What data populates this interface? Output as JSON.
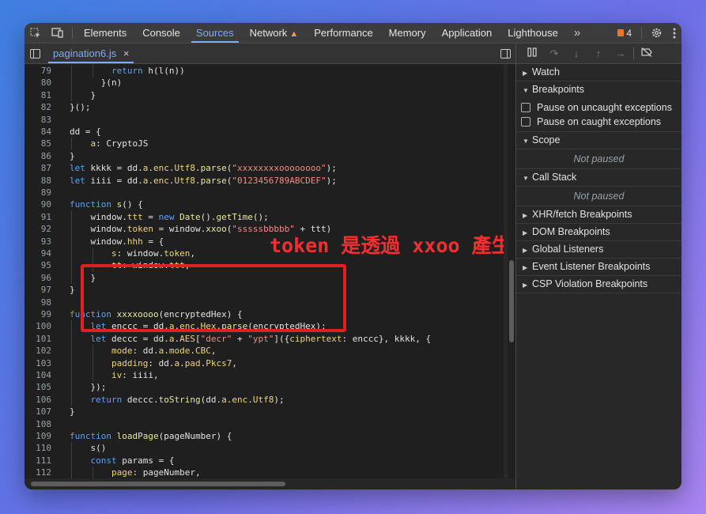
{
  "topbar": {
    "tabs": [
      "Elements",
      "Console",
      "Sources",
      "Network",
      "Performance",
      "Memory",
      "Application",
      "Lighthouse"
    ],
    "active_tab": "Sources",
    "more": "»",
    "issues_count": "4"
  },
  "editor": {
    "file_tab": "pagination6.js",
    "close": "×",
    "lines": [
      {
        "n": "79",
        "indent": 8,
        "html": "<span class='kw'>return</span> h(l(n))"
      },
      {
        "n": "80",
        "indent": 6,
        "html": "}(n)"
      },
      {
        "n": "81",
        "indent": 4,
        "html": "}"
      },
      {
        "n": "82",
        "indent": 0,
        "html": "}();"
      },
      {
        "n": "83",
        "indent": 0,
        "html": ""
      },
      {
        "n": "84",
        "indent": 0,
        "html": "dd = {"
      },
      {
        "n": "85",
        "indent": 4,
        "html": "<span class='pr'>a</span>: CryptoJS"
      },
      {
        "n": "86",
        "indent": 0,
        "html": "}"
      },
      {
        "n": "87",
        "indent": 0,
        "html": "<span class='kw'>let</span> kkkk = dd.<span class='pr'>a</span>.<span class='pr'>enc</span>.<span class='pr'>Utf8</span>.<span class='fn'>parse</span>(<span class='str'>\"xxxxxxxxoooooooo\"</span>);"
      },
      {
        "n": "88",
        "indent": 0,
        "html": "<span class='kw'>let</span> iiii = dd.<span class='pr'>a</span>.<span class='pr'>enc</span>.<span class='pr'>Utf8</span>.<span class='fn'>parse</span>(<span class='str'>\"0123456789ABCDEF\"</span>);"
      },
      {
        "n": "89",
        "indent": 0,
        "html": ""
      },
      {
        "n": "90",
        "indent": 0,
        "html": "<span class='kw'>function</span> <span class='fn'>s</span>() {"
      },
      {
        "n": "91",
        "indent": 4,
        "html": "window.<span class='pr'>ttt</span> = <span class='kw'>new</span> <span class='fn'>Date</span>().<span class='fn'>getTime</span>();"
      },
      {
        "n": "92",
        "indent": 4,
        "html": "window.<span class='pr'>token</span> = window.<span class='fn'>xxoo</span>(<span class='str'>\"sssssbbbbb\"</span> + ttt)"
      },
      {
        "n": "93",
        "indent": 4,
        "html": "window.<span class='pr'>hhh</span> = {"
      },
      {
        "n": "94",
        "indent": 8,
        "html": "<span class='pr'>s</span>: window.<span class='pr'>token</span>,"
      },
      {
        "n": "95",
        "indent": 8,
        "html": "<span class='pr'>tt</span>: window.<span class='pr'>ttt</span>,"
      },
      {
        "n": "96",
        "indent": 4,
        "html": "}"
      },
      {
        "n": "97",
        "indent": 0,
        "html": "}"
      },
      {
        "n": "98",
        "indent": 0,
        "html": ""
      },
      {
        "n": "99",
        "indent": 0,
        "html": "<span class='kw'>function</span> <span class='fn'>xxxxoooo</span>(<span class='vs'>encryptedHex</span>) {"
      },
      {
        "n": "100",
        "indent": 4,
        "html": "<span class='kw'>let</span> enccc = dd.<span class='pr'>a</span>.<span class='pr'>enc</span>.<span class='pr'>Hex</span>.<span class='fn'>parse</span>(encryptedHex);"
      },
      {
        "n": "101",
        "indent": 4,
        "html": "<span class='kw'>let</span> deccc = dd.<span class='pr'>a</span>.<span class='pr'>AES</span>[<span class='str'>\"decr\"</span> + <span class='str'>\"ypt\"</span>]({<span class='pr'>ciphertext</span>: enccc}, kkkk, {"
      },
      {
        "n": "102",
        "indent": 8,
        "html": "<span class='pr'>mode</span>: dd.<span class='pr'>a</span>.<span class='pr'>mode</span>.<span class='pr'>CBC</span>,"
      },
      {
        "n": "103",
        "indent": 8,
        "html": "<span class='pr'>padding</span>: dd.<span class='pr'>a</span>.<span class='pr'>pad</span>.<span class='pr'>Pkcs7</span>,"
      },
      {
        "n": "104",
        "indent": 8,
        "html": "<span class='pr'>iv</span>: iiii,"
      },
      {
        "n": "105",
        "indent": 4,
        "html": "});"
      },
      {
        "n": "106",
        "indent": 4,
        "html": "<span class='kw'>return</span> deccc.<span class='fn'>toString</span>(dd.<span class='pr'>a</span>.<span class='pr'>enc</span>.<span class='pr'>Utf8</span>);"
      },
      {
        "n": "107",
        "indent": 0,
        "html": "}"
      },
      {
        "n": "108",
        "indent": 0,
        "html": ""
      },
      {
        "n": "109",
        "indent": 0,
        "html": "<span class='kw'>function</span> <span class='fn'>loadPage</span>(<span class='vs'>pageNumber</span>) {"
      },
      {
        "n": "110",
        "indent": 4,
        "html": "s()"
      },
      {
        "n": "111",
        "indent": 4,
        "html": "<span class='kw'>const</span> params = {"
      },
      {
        "n": "112",
        "indent": 8,
        "html": "<span class='pr'>page</span>: pageNumber,"
      }
    ]
  },
  "annotation": {
    "text": "token 是透過 xxoo 產生",
    "color": "#e02020"
  },
  "debugger": {
    "watch": "Watch",
    "breakpoints": "Breakpoints",
    "pause_uncaught": "Pause on uncaught exceptions",
    "pause_caught": "Pause on caught exceptions",
    "scope": "Scope",
    "not_paused_1": "Not paused",
    "call_stack": "Call Stack",
    "not_paused_2": "Not paused",
    "collapsed_sections": [
      "XHR/fetch Breakpoints",
      "DOM Breakpoints",
      "Global Listeners",
      "Event Listener Breakpoints",
      "CSP Violation Breakpoints"
    ]
  },
  "colors": {
    "accent": "#7cacf8",
    "background": "#282828",
    "keyword": "#5ea2f0",
    "string": "#f28b82"
  }
}
